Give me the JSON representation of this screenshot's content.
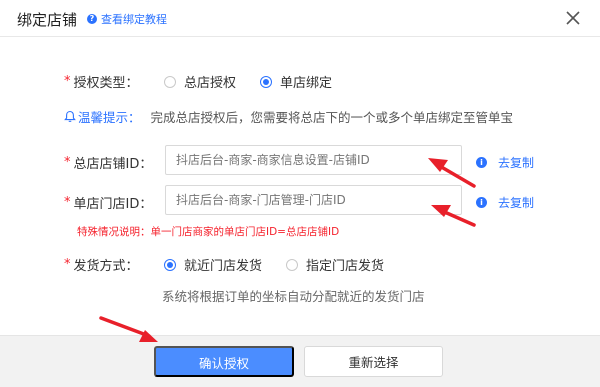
{
  "header": {
    "title": "绑定店铺",
    "help_link": "查看绑定教程"
  },
  "form": {
    "auth_type": {
      "label": "授权类型：",
      "options": [
        "总店授权",
        "单店绑定"
      ],
      "selected": "单店绑定"
    },
    "tip": {
      "label": "温馨提示：",
      "text": "完成总店授权后，您需要将总店下的一个或多个单店绑定至管单宝"
    },
    "shop_id": {
      "label": "总店店铺ID：",
      "placeholder": "抖店后台-商家-商家信息设置-店铺ID",
      "copy_label": "去复制"
    },
    "store_id": {
      "label": "单店门店ID：",
      "placeholder": "抖店后台-商家-门店管理-门店ID",
      "copy_label": "去复制"
    },
    "special_note": "特殊情况说明：单一门店商家的单店门店ID=总店店铺ID",
    "delivery": {
      "label": "发货方式：",
      "options": [
        "就近门店发货",
        "指定门店发货"
      ],
      "selected": "就近门店发货",
      "description": "系统将根据订单的坐标自动分配就近的发货门店"
    }
  },
  "footer": {
    "confirm_label": "确认授权",
    "reselect_label": "重新选择"
  },
  "colors": {
    "primary": "#2b72ff",
    "button_primary": "#4b8dff",
    "required": "#f5222d",
    "annotation_arrow": "#e8202a"
  },
  "icons": [
    "help-icon",
    "close-icon",
    "bell-icon",
    "info-icon",
    "annotation-arrow"
  ]
}
